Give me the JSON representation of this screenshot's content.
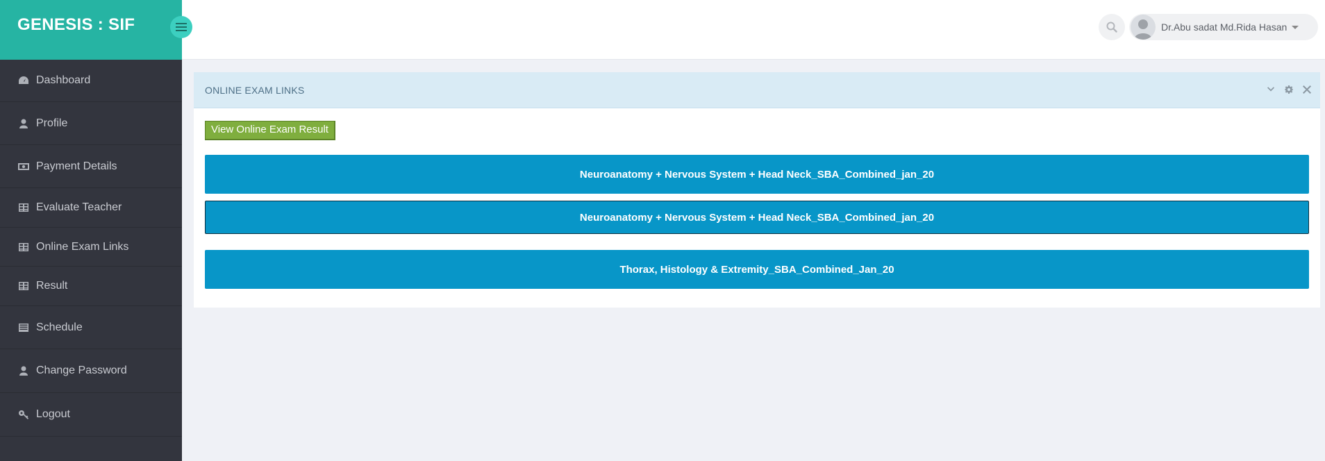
{
  "brand": {
    "title": "GENESIS : SIF"
  },
  "header": {
    "user_name": "Dr.Abu sadat Md.Rida Hasan"
  },
  "sidebar": {
    "items": [
      {
        "label": "Dashboard",
        "icon": "dashboard-icon"
      },
      {
        "label": "Profile",
        "icon": "user-icon"
      },
      {
        "label": "Payment Details",
        "icon": "money-icon"
      },
      {
        "label": "Evaluate Teacher",
        "icon": "table-icon"
      },
      {
        "label": "Online Exam Links",
        "icon": "table-icon"
      },
      {
        "label": "Result",
        "icon": "table-icon"
      },
      {
        "label": "Schedule",
        "icon": "list-icon"
      },
      {
        "label": "Change Password",
        "icon": "user-icon"
      },
      {
        "label": "Logout",
        "icon": "key-icon"
      }
    ]
  },
  "panel": {
    "title": "ONLINE EXAM LINKS",
    "result_button": "View Online Exam Result",
    "exams": [
      "Neuroanatomy + Nervous System + Head Neck_SBA_Combined_jan_20",
      "Neuroanatomy + Nervous System + Head Neck_SBA_Combined_jan_20",
      "Thorax, Histology & Extremity_SBA_Combined_Jan_20"
    ]
  },
  "colors": {
    "brand": "#26b4a3",
    "sidebar": "#33353e",
    "exam_button": "#0896c8",
    "result_button": "#7fae3e",
    "panel_header": "#d9ebf5"
  }
}
